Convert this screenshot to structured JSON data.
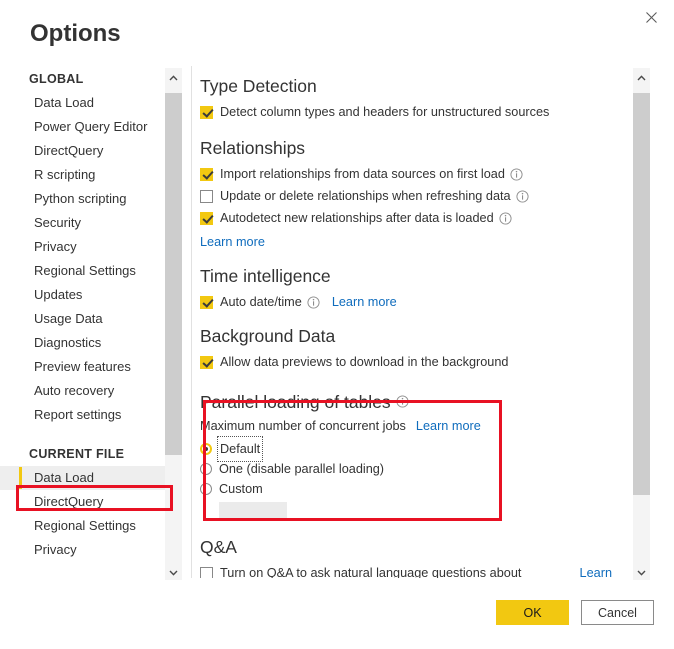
{
  "dialog": {
    "title": "Options",
    "close_icon": "close-icon"
  },
  "sidebar": {
    "global_header": "GLOBAL",
    "global_items": [
      {
        "label": "Data Load"
      },
      {
        "label": "Power Query Editor"
      },
      {
        "label": "DirectQuery"
      },
      {
        "label": "R scripting"
      },
      {
        "label": "Python scripting"
      },
      {
        "label": "Security"
      },
      {
        "label": "Privacy"
      },
      {
        "label": "Regional Settings"
      },
      {
        "label": "Updates"
      },
      {
        "label": "Usage Data"
      },
      {
        "label": "Diagnostics"
      },
      {
        "label": "Preview features"
      },
      {
        "label": "Auto recovery"
      },
      {
        "label": "Report settings"
      }
    ],
    "current_file_header": "CURRENT FILE",
    "current_file_items": [
      {
        "label": "Data Load",
        "selected": true
      },
      {
        "label": "DirectQuery",
        "selected": false
      },
      {
        "label": "Regional Settings",
        "selected": false
      },
      {
        "label": "Privacy",
        "selected": false
      }
    ]
  },
  "content": {
    "type_detection": {
      "title": "Type Detection",
      "detect_columns_label": "Detect column types and headers for unstructured sources",
      "detect_columns_checked": true
    },
    "relationships": {
      "title": "Relationships",
      "import_label": "Import relationships from data sources on first load",
      "import_checked": true,
      "update_label": "Update or delete relationships when refreshing data",
      "update_checked": false,
      "autodetect_label": "Autodetect new relationships after data is loaded",
      "autodetect_checked": true,
      "learn_more": "Learn more"
    },
    "time_intelligence": {
      "title": "Time intelligence",
      "auto_date_label": "Auto date/time",
      "auto_date_checked": true,
      "learn_more": "Learn more"
    },
    "background_data": {
      "title": "Background Data",
      "allow_previews_label": "Allow data previews to download in the background",
      "allow_previews_checked": true
    },
    "parallel_loading": {
      "title": "Parallel loading of tables",
      "max_jobs_label": "Maximum number of concurrent jobs",
      "learn_more": "Learn more",
      "options": [
        {
          "label": "Default",
          "selected": true,
          "focused": true
        },
        {
          "label": "One (disable parallel loading)",
          "selected": false,
          "focused": false
        },
        {
          "label": "Custom",
          "selected": false,
          "focused": false
        }
      ],
      "custom_value": "",
      "custom_placeholder": ""
    },
    "qna": {
      "title": "Q&A",
      "turn_on_label": "Turn on Q&A to ask natural language questions about",
      "turn_on_checked": false,
      "learn_link": "Learn"
    }
  },
  "footer": {
    "ok_label": "OK",
    "cancel_label": "Cancel"
  },
  "colors": {
    "accent_yellow": "#f2c811",
    "link_blue": "#0f6cbd",
    "annotation_red": "#e81123",
    "selected_bg": "#eeeeee"
  },
  "scrollbars": {
    "left": {
      "up_icon": "chevron-up-icon",
      "down_icon": "chevron-down-icon"
    },
    "right": {
      "up_icon": "chevron-up-icon",
      "down_icon": "chevron-down-icon"
    }
  }
}
